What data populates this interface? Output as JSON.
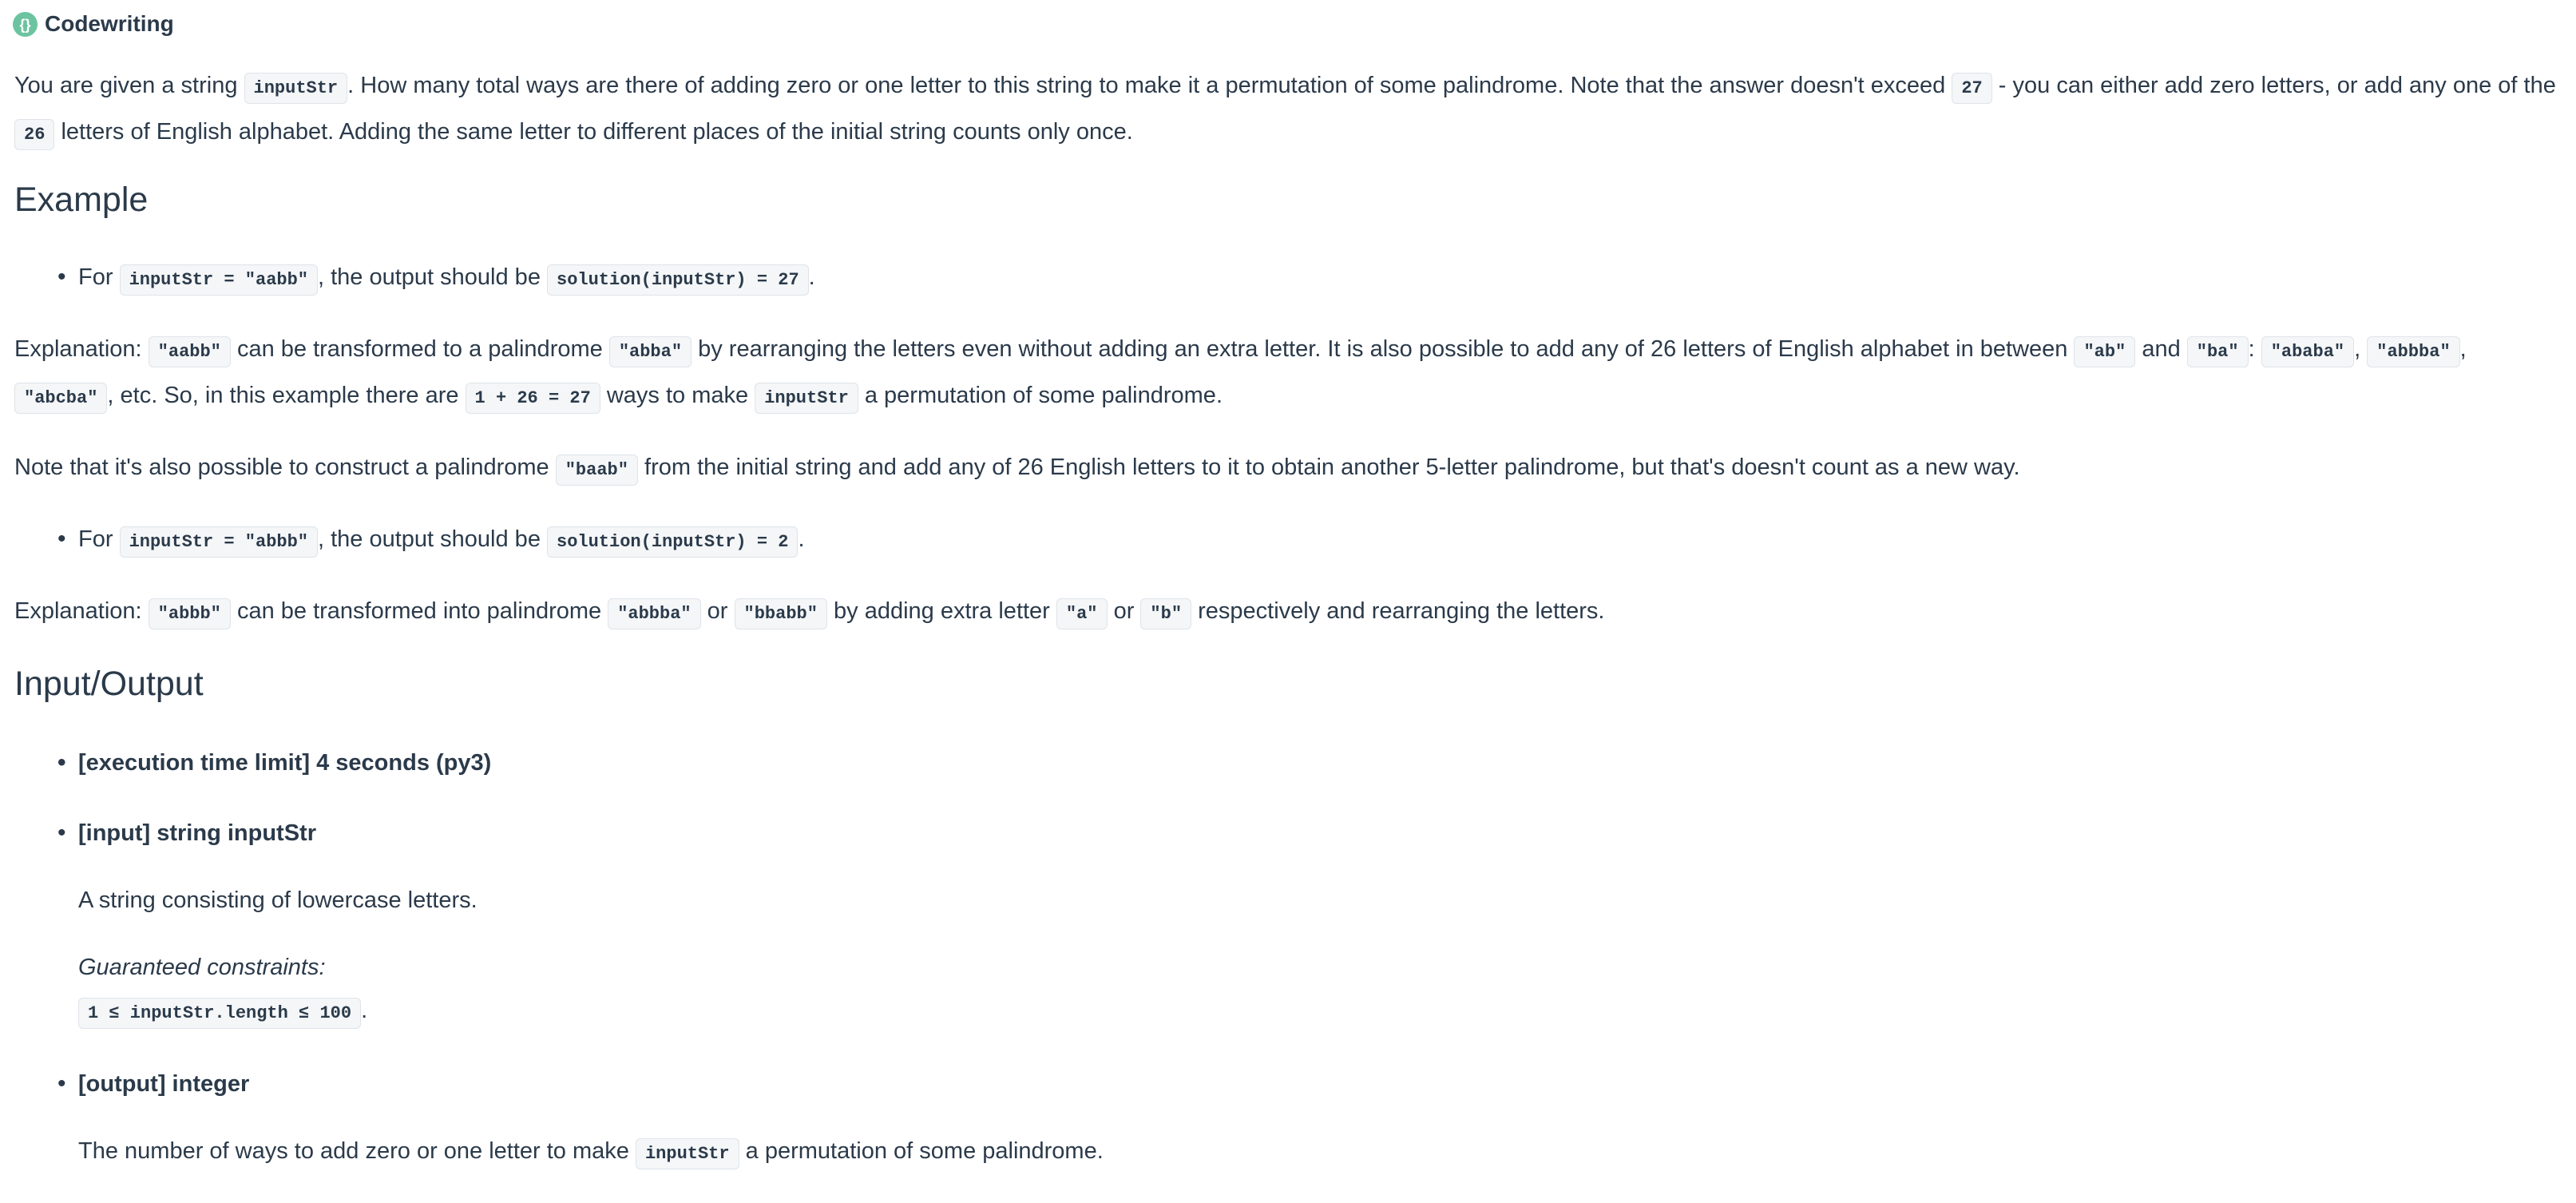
{
  "app": {
    "title": "Codewriting"
  },
  "intro": {
    "t1": "You are given a string ",
    "c1": "inputStr",
    "t2": ". How many total ways are there of adding zero or one letter to this string to make it a permutation of some palindrome. Note that the answer doesn't exceed ",
    "c2": "27",
    "t3": " - you can either add zero letters, or add any one of the ",
    "c3": "26",
    "t4": " letters of English alphabet. Adding the same letter to different places of the initial string counts only once."
  },
  "example": {
    "heading": "Example",
    "ex1": {
      "t1": "For ",
      "c1": "inputStr = \"aabb\"",
      "t2": ", the output should be ",
      "c2": "solution(inputStr) = 27",
      "t3": "."
    },
    "expl1": {
      "t1": "Explanation: ",
      "c1": "\"aabb\"",
      "t2": " can be transformed to a palindrome ",
      "c2": "\"abba\"",
      "t3": " by rearranging the letters even without adding an extra letter. It is also possible to add any of 26 letters of English alphabet in between ",
      "c3": "\"ab\"",
      "t4": " and ",
      "c4": "\"ba\"",
      "t5": ": ",
      "c5": "\"ababa\"",
      "t6": ", ",
      "c6": "\"abbba\"",
      "t7": ", ",
      "c7": "\"abcba\"",
      "t8": ", etc. So, in this example there are ",
      "c8": "1 + 26 = 27",
      "t9": " ways to make ",
      "c9": "inputStr",
      "t10": " a permutation of some palindrome."
    },
    "note": {
      "t1": "Note that it's also possible to construct a palindrome ",
      "c1": "\"baab\"",
      "t2": " from the initial string and add any of 26 English letters to it to obtain another 5-letter palindrome, but that's doesn't count as a new way."
    },
    "ex2": {
      "t1": "For ",
      "c1": "inputStr = \"abbb\"",
      "t2": ", the output should be ",
      "c2": "solution(inputStr) = 2",
      "t3": "."
    },
    "expl2": {
      "t1": "Explanation: ",
      "c1": "\"abbb\"",
      "t2": " can be transformed into palindrome ",
      "c2": "\"abbba\"",
      "t3": " or ",
      "c3": "\"bbabb\"",
      "t4": " by adding extra letter ",
      "c4": "\"a\"",
      "t5": " or ",
      "c5": "\"b\"",
      "t6": " respectively and rearranging the letters."
    }
  },
  "io": {
    "heading": "Input/Output",
    "time_limit": "[execution time limit] 4 seconds (py3)",
    "input_label": "[input] string inputStr",
    "input_desc": "A string consisting of lowercase letters.",
    "constraints_label": "Guaranteed constraints:",
    "constraints_code": "1 ≤ inputStr.length ≤ 100",
    "constraints_end": ".",
    "output_label": "[output] integer",
    "output_t1": "The number of ways to add zero or one letter to make ",
    "output_c1": "inputStr",
    "output_t2": " a permutation of some palindrome."
  }
}
